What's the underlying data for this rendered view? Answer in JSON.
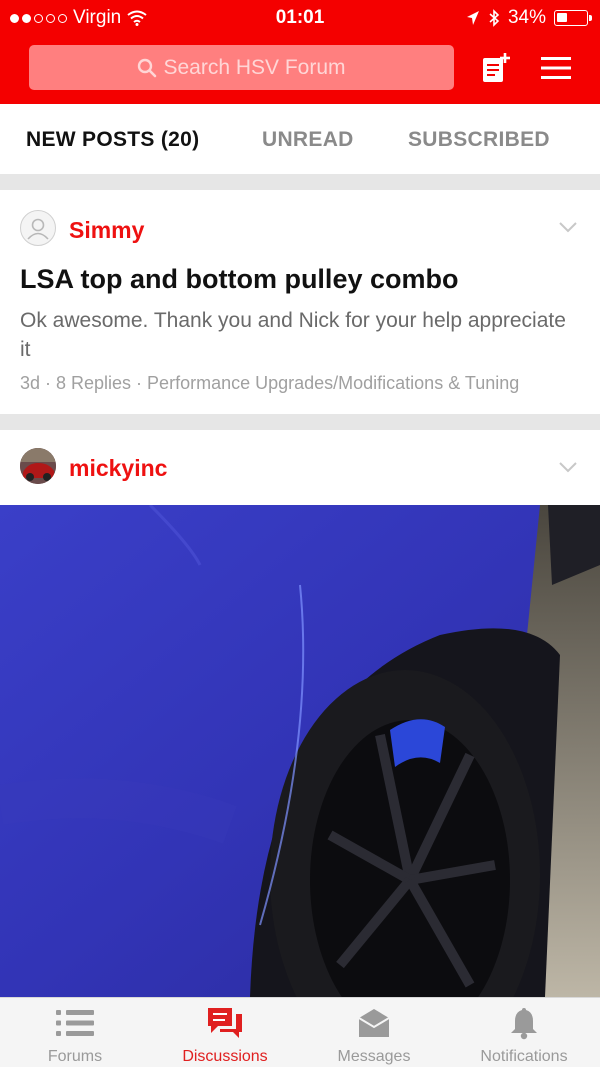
{
  "status_bar": {
    "carrier": "Virgin",
    "time": "01:01",
    "battery_percent": "34%",
    "battery_level": 0.34,
    "signal_bars_filled": 2,
    "signal_bars_total": 5
  },
  "header": {
    "search_placeholder": "Search HSV Forum",
    "icons": [
      "search-icon",
      "new-post-icon",
      "menu-icon"
    ]
  },
  "tabs": [
    {
      "label": "NEW POSTS (20)",
      "active": true
    },
    {
      "label": "UNREAD",
      "active": false
    },
    {
      "label": "SUBSCRIBED",
      "active": false
    }
  ],
  "posts": [
    {
      "author": "Simmy",
      "title": "LSA top and bottom pulley combo",
      "snippet": "Ok awesome. Thank you and Nick for your help appreciate it",
      "meta": "3d · 8 Replies · Performance Upgrades/Modifications & Tuning"
    },
    {
      "author": "mickyinc"
    }
  ],
  "bottom_nav": [
    {
      "label": "Forums",
      "icon": "list-icon",
      "active": false
    },
    {
      "label": "Discussions",
      "icon": "chat-icon",
      "active": true
    },
    {
      "label": "Messages",
      "icon": "envelope-icon",
      "active": false
    },
    {
      "label": "Notifications",
      "icon": "bell-icon",
      "active": false
    }
  ],
  "colors": {
    "brand_red": "#f40000",
    "accent_red": "#ee1111",
    "inactive_gray": "#8a8a8a"
  }
}
